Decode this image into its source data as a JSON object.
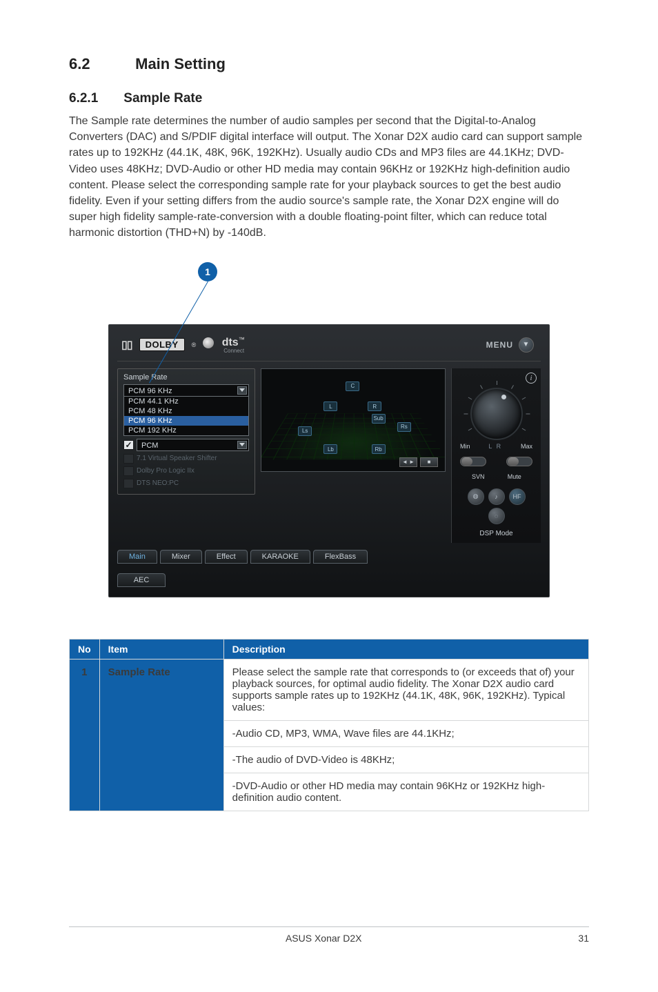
{
  "section": {
    "num": "6.2",
    "title": "Main Setting"
  },
  "subsection": {
    "num": "6.2.1",
    "title": "Sample Rate"
  },
  "paragraph": "The Sample rate determines the number of audio samples per second that the Digital-to-Analog Converters (DAC) and S/PDIF digital interface will output. The Xonar D2X audio card can support sample rates up to 192KHz (44.1K, 48K, 96K, 192KHz). Usually audio CDs and MP3 files are 44.1KHz; DVD-Video uses 48KHz; DVD-Audio or other HD media may contain 96KHz or 192KHz high-definition audio content. Please select the corresponding sample rate for your playback sources to get the best audio fidelity. Even if your setting differs from the audio source's sample rate, the Xonar D2X engine will do super high fidelity sample-rate-conversion with a double floating-point filter, which can reduce total harmonic distortion (THD+N) by -140dB.",
  "callout": {
    "num": "1"
  },
  "app": {
    "dolby_pre": "D",
    "dolby_box": "DOLBY",
    "dolby_r": "®",
    "dts": "dts",
    "dts_tm": "™",
    "dts_connect": "Connect",
    "menu": "MENU",
    "sample_rate_label": "Sample Rate",
    "selected_rate": "PCM 96 KHz",
    "rates": [
      "PCM 44.1 KHz",
      "PCM 48 KHz",
      "PCM 96 KHz",
      "PCM 192 KHz"
    ],
    "output_selected": "PCM",
    "opt_vss": "7.1 Virtual Speaker Shifter",
    "opt_dpl": "Dolby Pro Logic IIx",
    "opt_dts": "DTS NEO:PC",
    "spk": {
      "c": "C",
      "l": "L",
      "r": "R",
      "ls": "Ls",
      "rs": "Rs",
      "lb": "Lb",
      "rb": "Rb",
      "sub": "Sub"
    },
    "ctrl_rot": "◄ ►",
    "ctrl_stop": "■",
    "vol_min": "Min",
    "vol_mid": "L    R",
    "vol_max": "Max",
    "svn": "SVN",
    "mute": "Mute",
    "hf": "HF",
    "dsp_mode": "DSP Mode",
    "tabs": {
      "main": "Main",
      "mixer": "Mixer",
      "effect": "Effect",
      "karaoke": "KARAOKE",
      "flex": "FlexBass",
      "aec": "AEC"
    }
  },
  "table": {
    "h_no": "No",
    "h_item": "Item",
    "h_desc": "Description",
    "r1_no": "1",
    "r1_item": "Sample Rate",
    "r1_p1": "Please select the sample rate that corresponds to (or exceeds that of) your playback sources, for optimal audio fidelity. The Xonar D2X audio card supports sample rates up to 192KHz (44.1K, 48K, 96K, 192KHz). Typical values:",
    "r1_p2": "-Audio CD, MP3, WMA, Wave files are 44.1KHz;",
    "r1_p3": "-The audio of DVD-Video is 48KHz;",
    "r1_p4": "-DVD-Audio or other HD media may contain 96KHz or 192KHz high-definition audio content."
  },
  "footer": {
    "product": "ASUS Xonar D2X",
    "page": "31"
  }
}
